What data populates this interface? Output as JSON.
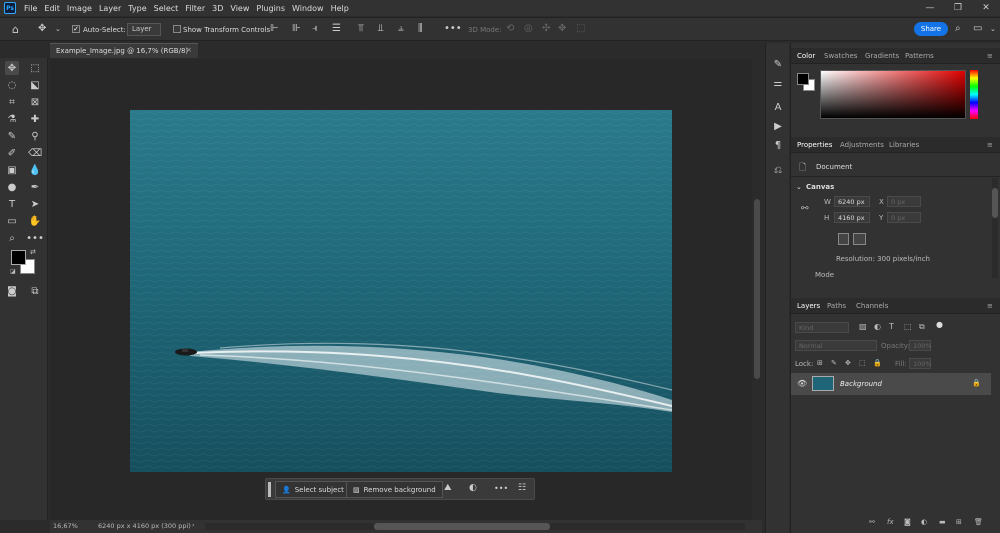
{
  "app": {
    "logo": "Ps"
  },
  "menu": [
    "File",
    "Edit",
    "Image",
    "Layer",
    "Type",
    "Select",
    "Filter",
    "3D",
    "View",
    "Plugins",
    "Window",
    "Help"
  ],
  "window_controls": {
    "minimize": "—",
    "restore": "❐",
    "close": "✕"
  },
  "options_bar": {
    "auto_select_label": "Auto-Select:",
    "auto_select_value": "Layer",
    "show_transform_label": "Show Transform Controls",
    "mode_3d_label": "3D Mode:",
    "share_label": "Share"
  },
  "document": {
    "tab_title": "Example_Image.jpg @ 16,7% (RGB/8)",
    "close": "×"
  },
  "context_bar": {
    "select_subject": "Select subject",
    "remove_background": "Remove background",
    "more": "•••"
  },
  "status": {
    "zoom": "16,67%",
    "info": "6240 px x 4160 px (300 ppi)",
    "arrow": "›"
  },
  "color_panel": {
    "tabs": [
      "Color",
      "Swatches",
      "Gradients",
      "Patterns"
    ],
    "active": 0
  },
  "properties_panel": {
    "tabs": [
      "Properties",
      "Adjustments",
      "Libraries"
    ],
    "doc_label": "Document",
    "section": "Canvas",
    "w_label": "W",
    "w_value": "6240 px",
    "h_label": "H",
    "h_value": "4160 px",
    "x_label": "X",
    "x_placeholder": "0 px",
    "y_label": "Y",
    "y_placeholder": "0 px",
    "resolution": "Resolution: 300 pixels/inch",
    "mode_label": "Mode"
  },
  "layers_panel": {
    "tabs": [
      "Layers",
      "Paths",
      "Channels"
    ],
    "filter_placeholder": "Kind",
    "blend_mode": "Normal",
    "opacity_label": "Opacity:",
    "opacity_value": "100%",
    "lock_label": "Lock:",
    "fill_label": "Fill:",
    "fill_value": "100%",
    "layers": [
      {
        "name": "Background",
        "visible": true,
        "locked": true
      }
    ],
    "footer_icons": [
      "link-icon",
      "fx-icon",
      "mask-icon",
      "adjustment-icon",
      "folder-icon",
      "new-layer-icon",
      "trash-icon"
    ]
  },
  "colors": {
    "accent": "#1473e6",
    "panel": "#323232",
    "canvas": "#282828",
    "water": "#1a5f6e"
  }
}
